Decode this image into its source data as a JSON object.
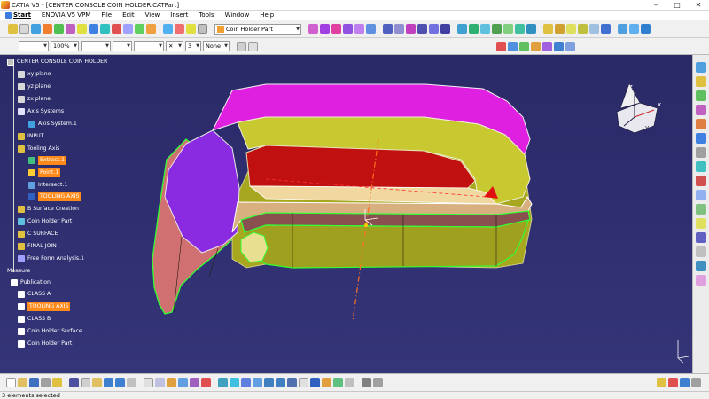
{
  "window": {
    "title": "CATIA V5 - [CENTER CONSOLE COIN HOLDER.CATPart]",
    "controls": [
      "–",
      "□",
      "✕"
    ]
  },
  "menu": [
    "Start",
    "ENOVIA V5 VPM",
    "File",
    "Edit",
    "View",
    "Insert",
    "Tools",
    "Window",
    "Help"
  ],
  "toolbar": {
    "zoom_value": "100%",
    "count_value": "3",
    "line_value": "None",
    "part_combo": "Coin Holder Part",
    "x_button": "✕"
  },
  "tree": {
    "root": "CENTER CONSOLE COIN HOLDER",
    "nodes": [
      {
        "label": "xy plane",
        "highlight": false
      },
      {
        "label": "yz plane",
        "highlight": false
      },
      {
        "label": "zx plane",
        "highlight": false
      },
      {
        "label": "Axis Systems",
        "highlight": false
      },
      {
        "label": "Axis System.1",
        "highlight": false
      },
      {
        "label": "INPUT",
        "highlight": false
      },
      {
        "label": "Tooling Axis",
        "highlight": false
      },
      {
        "label": "Extract.1",
        "highlight": true
      },
      {
        "label": "Point.1",
        "highlight": true
      },
      {
        "label": "Intersect.1",
        "highlight": false
      },
      {
        "label": "TOOLING AXIS",
        "highlight": true
      },
      {
        "label": "B Surface Creation",
        "highlight": false
      },
      {
        "label": "Coin Holder Part",
        "highlight": false
      },
      {
        "label": "C SURFACE",
        "highlight": false
      },
      {
        "label": "FINAL JOIN",
        "highlight": false
      },
      {
        "label": "Free Form Analysis.1",
        "highlight": false
      },
      {
        "label": "Measure",
        "highlight": false
      },
      {
        "label": "Publication",
        "highlight": false
      },
      {
        "label": "CLASS A",
        "highlight": false
      },
      {
        "label": "TOOLING AXIS",
        "highlight": true
      },
      {
        "label": "CLASS B",
        "highlight": false
      },
      {
        "label": "Coin Holder Surface",
        "highlight": false
      },
      {
        "label": "Coin Holder Part",
        "highlight": false
      }
    ]
  },
  "compass": {
    "x_label": "x",
    "y_label": "y",
    "z_label": "z"
  },
  "status": {
    "text": "3 elements selected"
  },
  "colors": {
    "viewport_bg": "#2c2c6c",
    "highlight": "#ff8a1a",
    "magenta": "#e020e0",
    "purple": "#8a2be2",
    "olive": "#b0b020",
    "red": "#c01010",
    "pink": "#d07070",
    "green_edge": "#33ff33"
  }
}
